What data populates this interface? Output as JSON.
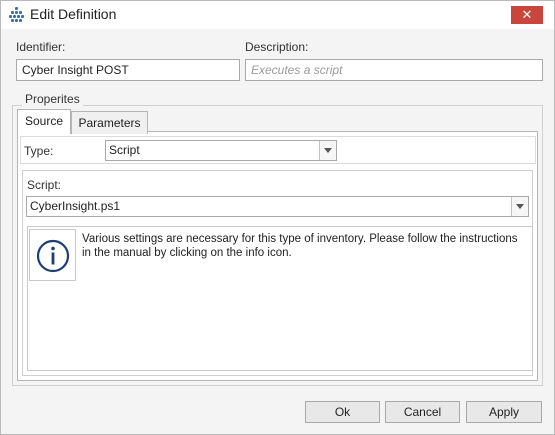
{
  "window": {
    "title": "Edit Definition",
    "close_glyph": "✕",
    "icon": "grid-dots-icon"
  },
  "identifier": {
    "label": "Identifier:",
    "value": "Cyber Insight POST"
  },
  "description": {
    "label": "Description:",
    "value": "",
    "placeholder": "Executes a script"
  },
  "properties": {
    "group_label": "Properites",
    "tabs": [
      {
        "label": "Source",
        "active": true
      },
      {
        "label": "Parameters",
        "active": false
      }
    ],
    "type": {
      "label": "Type:",
      "value": "Script"
    },
    "script": {
      "label": "Script:",
      "value": "CyberInsight.ps1"
    },
    "info": {
      "icon": "info-icon",
      "text": "Various settings are necessary for this type of inventory. Please follow the instructions in the manual by clicking on the info icon."
    }
  },
  "buttons": {
    "ok": "Ok",
    "cancel": "Cancel",
    "apply": "Apply"
  },
  "colors": {
    "close_button": "#c9463d",
    "info_icon": "#1f3f73",
    "app_icon": "#3a6fb0"
  }
}
